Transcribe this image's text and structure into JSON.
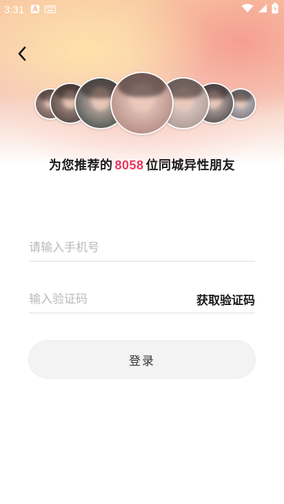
{
  "status_bar": {
    "time": "3:31",
    "icons": [
      "a-badge-icon",
      "keyboard-icon",
      "wifi-icon",
      "signal-icon",
      "battery-icon"
    ]
  },
  "header": {
    "back_icon": "chevron-left-icon"
  },
  "avatars_icon": "user-avatars",
  "headline": {
    "prefix": "为您推荐的",
    "count": "8058",
    "suffix": "位同城异性朋友"
  },
  "form": {
    "phone": {
      "placeholder": "请输入手机号",
      "value": ""
    },
    "code": {
      "placeholder": "输入验证码",
      "value": ""
    },
    "get_code_label": "获取验证码",
    "login_label": "登录"
  },
  "colors": {
    "accent": "#e8385f",
    "button_bg": "#f3f3f3",
    "text_primary": "#1a1a1a",
    "placeholder": "#b9b9b9"
  }
}
